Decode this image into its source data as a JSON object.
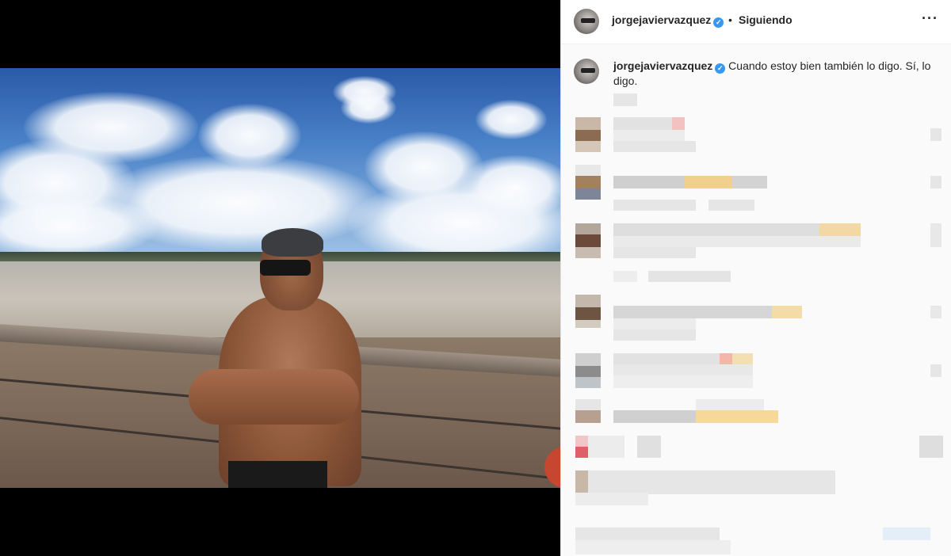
{
  "post": {
    "author": "jorgejavierv​azquez",
    "follow_status": "Siguiendo",
    "separator": "•",
    "verified_icon": "verified-badge-icon",
    "more_icon": "more-options-icon",
    "caption_author": "jorgejavierv​azquez",
    "caption_text": "Cuando estoy bien también lo digo. Sí, lo digo."
  },
  "colors": {
    "verified": "#3897f0",
    "panel_bg": "#fafafa",
    "text": "#262626"
  }
}
